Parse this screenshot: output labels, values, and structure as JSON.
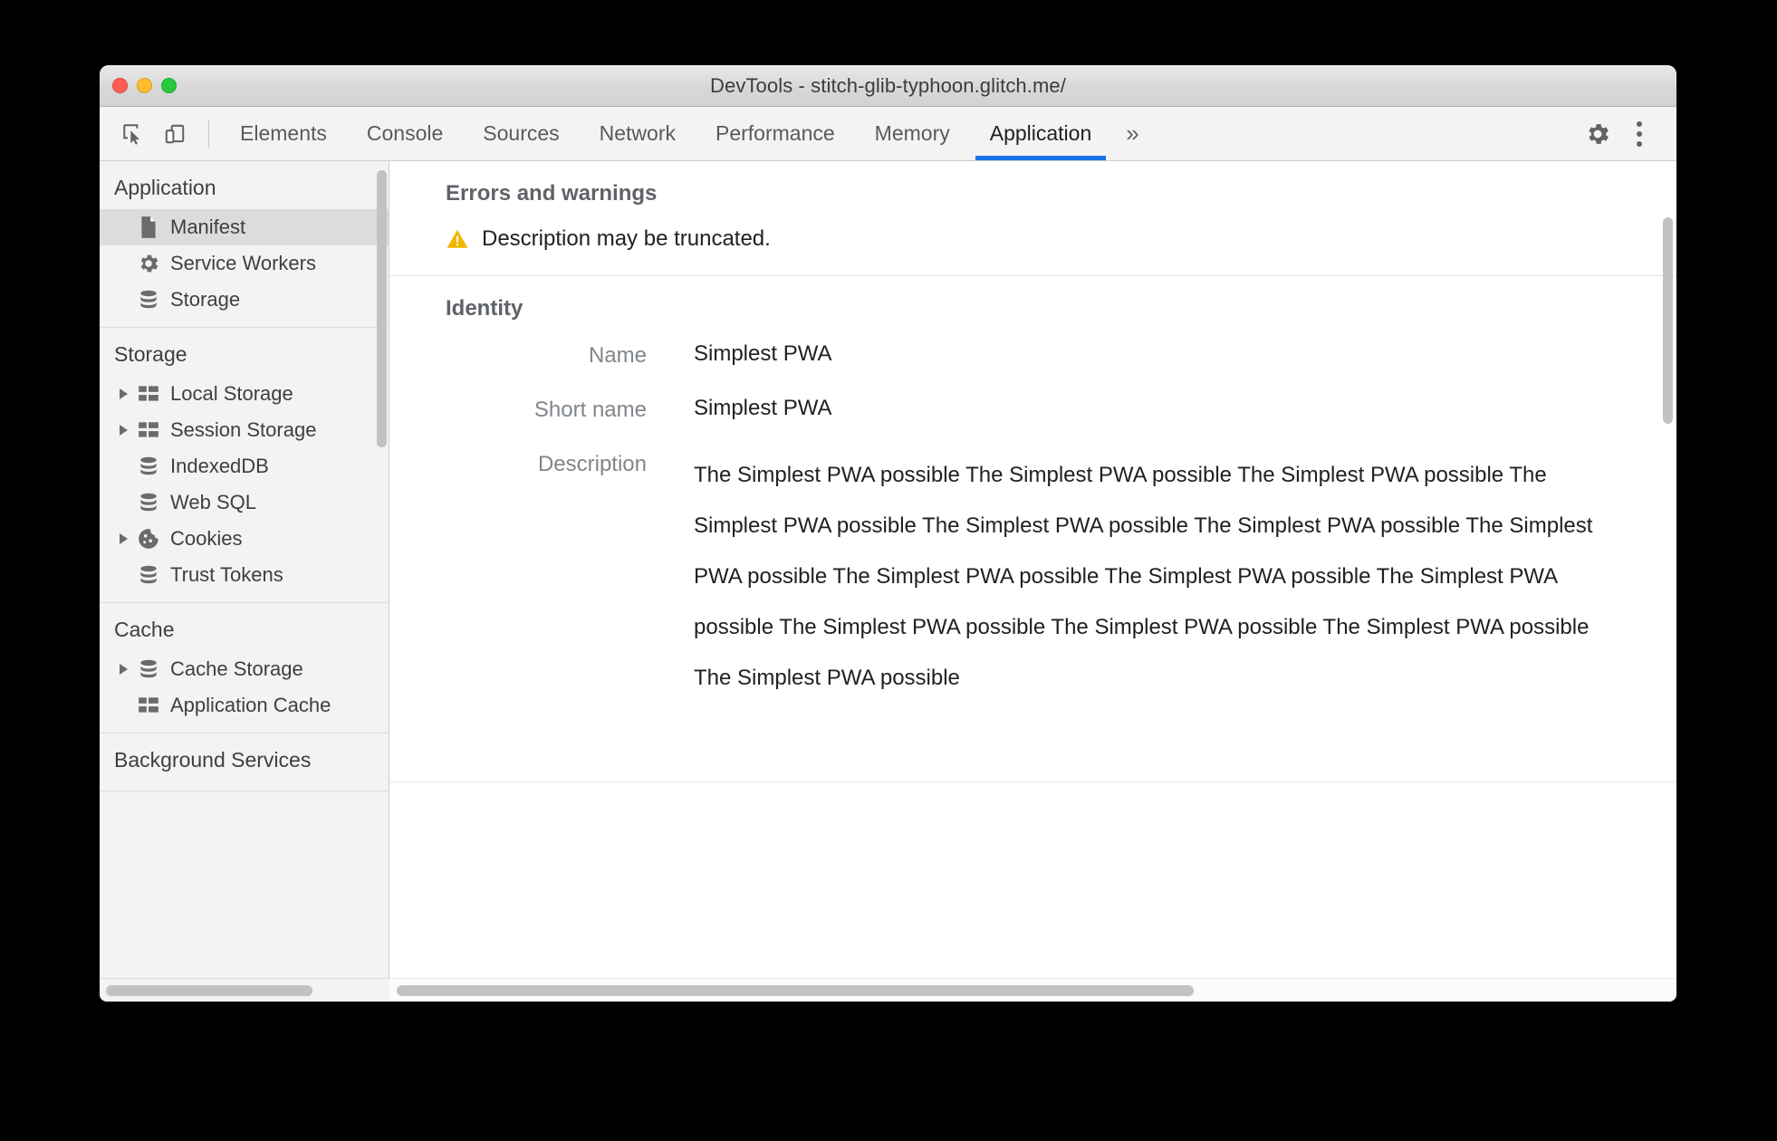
{
  "window": {
    "title": "DevTools - stitch-glib-typhoon.glitch.me/",
    "traffic_lights": [
      "close",
      "minimize",
      "zoom"
    ]
  },
  "colors": {
    "accent": "#1a73e8",
    "warning": "#f2b600",
    "selected_row": "#dcdcdc",
    "sidebar_bg": "#f3f3f3",
    "text_primary": "#202124",
    "text_secondary": "#80868b"
  },
  "toolbar": {
    "inspect_icon": "inspect-element-icon",
    "device_icon": "device-toolbar-icon",
    "overflow_label": "»",
    "settings_icon": "gear-icon",
    "menu_icon": "more-vertical-icon",
    "tabs": [
      {
        "label": "Elements",
        "active": false
      },
      {
        "label": "Console",
        "active": false
      },
      {
        "label": "Sources",
        "active": false
      },
      {
        "label": "Network",
        "active": false
      },
      {
        "label": "Performance",
        "active": false
      },
      {
        "label": "Memory",
        "active": false
      },
      {
        "label": "Application",
        "active": true
      }
    ]
  },
  "sidebar": {
    "sections": [
      {
        "title": "Application",
        "items": [
          {
            "label": "Manifest",
            "icon": "document-icon",
            "expandable": false,
            "selected": true
          },
          {
            "label": "Service Workers",
            "icon": "gear-icon",
            "expandable": false,
            "selected": false
          },
          {
            "label": "Storage",
            "icon": "database-icon",
            "expandable": false,
            "selected": false
          }
        ]
      },
      {
        "title": "Storage",
        "items": [
          {
            "label": "Local Storage",
            "icon": "table-icon",
            "expandable": true,
            "selected": false
          },
          {
            "label": "Session Storage",
            "icon": "table-icon",
            "expandable": true,
            "selected": false
          },
          {
            "label": "IndexedDB",
            "icon": "database-icon",
            "expandable": false,
            "selected": false
          },
          {
            "label": "Web SQL",
            "icon": "database-icon",
            "expandable": false,
            "selected": false
          },
          {
            "label": "Cookies",
            "icon": "cookie-icon",
            "expandable": true,
            "selected": false
          },
          {
            "label": "Trust Tokens",
            "icon": "database-icon",
            "expandable": false,
            "selected": false
          }
        ]
      },
      {
        "title": "Cache",
        "items": [
          {
            "label": "Cache Storage",
            "icon": "database-icon",
            "expandable": true,
            "selected": false
          },
          {
            "label": "Application Cache",
            "icon": "table-icon",
            "expandable": false,
            "selected": false
          }
        ]
      },
      {
        "title": "Background Services",
        "items": []
      }
    ]
  },
  "main": {
    "errors_section": {
      "title": "Errors and warnings",
      "messages": [
        {
          "severity": "warning",
          "text": "Description may be truncated."
        }
      ]
    },
    "identity_section": {
      "title": "Identity",
      "fields": [
        {
          "label": "Name",
          "value": "Simplest PWA"
        },
        {
          "label": "Short name",
          "value": "Simplest PWA"
        },
        {
          "label": "Description",
          "value": "The Simplest PWA possible The Simplest PWA possible The Simplest PWA possible The Simplest PWA possible The Simplest PWA possible The Simplest PWA possible The Simplest PWA possible The Simplest PWA possible The Simplest PWA possible The Simplest PWA possible The Simplest PWA possible The Simplest PWA possible The Simplest PWA possible The Simplest PWA possible"
        }
      ]
    }
  }
}
